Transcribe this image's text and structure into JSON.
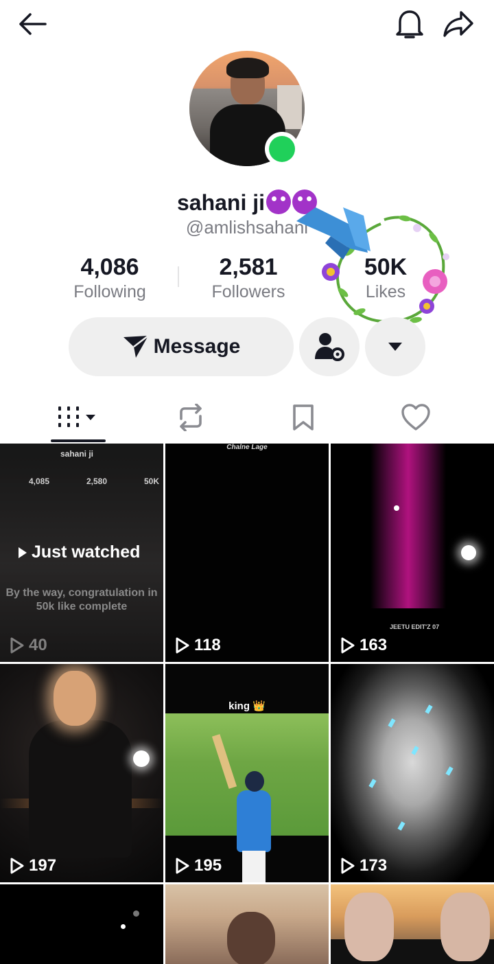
{
  "profile": {
    "display_name": "sahani ji",
    "username": "@amlishsahani",
    "online": true
  },
  "stats": {
    "following": {
      "value": "4,086",
      "label": "Following"
    },
    "followers": {
      "value": "2,581",
      "label": "Followers"
    },
    "likes": {
      "value": "50K",
      "label": "Likes"
    }
  },
  "actions": {
    "message_label": "Message"
  },
  "tabs": [
    {
      "name": "videos",
      "icon": "grid-icon",
      "active": true
    },
    {
      "name": "reposts",
      "icon": "repost-icon",
      "active": false
    },
    {
      "name": "saved",
      "icon": "bookmark-icon",
      "active": false
    },
    {
      "name": "liked",
      "icon": "heart-icon",
      "active": false
    }
  ],
  "videos": [
    {
      "views": "40",
      "badge": "Just watched",
      "preview": {
        "name": "sahani ji",
        "stats": [
          "4,085",
          "2,580",
          "50K"
        ],
        "caption": "By the way, congratulation in 50k like complete"
      }
    },
    {
      "views": "118",
      "caption": "Chalne Lage"
    },
    {
      "views": "163",
      "watermark": "JEETU EDIT'Z 07"
    },
    {
      "views": "197"
    },
    {
      "views": "195",
      "caption": "king 👑"
    },
    {
      "views": "173"
    },
    {
      "views": ""
    },
    {
      "views": ""
    },
    {
      "views": ""
    }
  ],
  "colors": {
    "text_primary": "#161823",
    "text_secondary": "#7a7b82",
    "button_bg": "#efefef",
    "online_green": "#20d05a"
  }
}
